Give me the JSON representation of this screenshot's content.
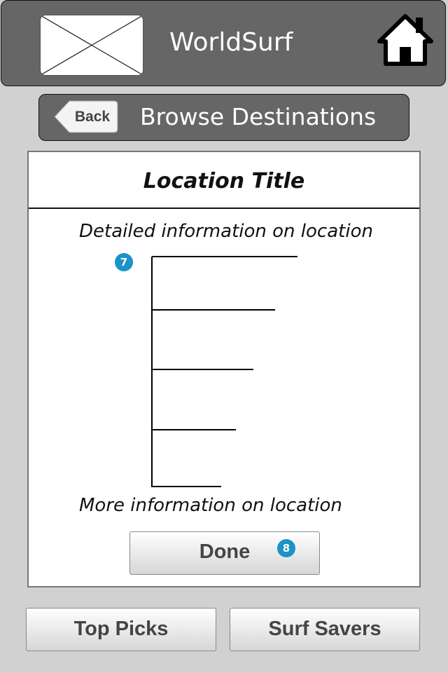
{
  "header": {
    "app_title": "WorldSurf",
    "logo_icon": "image-placeholder-icon",
    "home_icon": "home-icon"
  },
  "navbar": {
    "back_label": "Back",
    "title": "Browse Destinations"
  },
  "panel": {
    "location_title": "Location Title",
    "detail_text": "Detailed information on location",
    "more_text": "More information on location",
    "done_label": "Done"
  },
  "markers": {
    "tree_marker": "7",
    "done_marker": "8"
  },
  "bottom_nav": {
    "top_picks_label": "Top Picks",
    "surf_savers_label": "Surf Savers"
  },
  "colors": {
    "bar_background": "#666666",
    "page_background": "#d1d1d1",
    "marker": "#1a93c8"
  }
}
